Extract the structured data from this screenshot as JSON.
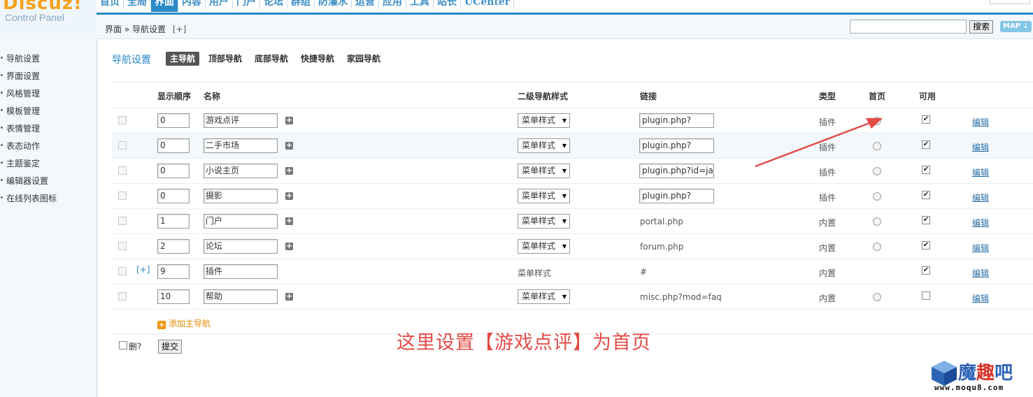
{
  "header": {
    "logo_name": "Discuz!",
    "logo_sub": "Control Panel",
    "nav": [
      "首页",
      "全局",
      "界面",
      "内容",
      "用户",
      "门户",
      "论坛",
      "群组",
      "防灌水",
      "运营",
      "应用",
      "工具",
      "站长",
      "UCenter"
    ],
    "active_nav": "界面",
    "breadcrumb": {
      "root": "界面",
      "sep": "»",
      "current": "导航设置",
      "plus": "[+]"
    },
    "search_value": "",
    "search_button": "搜索",
    "map_button": "MAP ⇣"
  },
  "sidebar": {
    "items": [
      "导航设置",
      "界面设置",
      "风格管理",
      "模板管理",
      "表情管理",
      "表态动作",
      "主题鉴定",
      "编辑器设置",
      "在线列表图标"
    ]
  },
  "page": {
    "title": "导航设置",
    "tabs": [
      "主导航",
      "顶部导航",
      "底部导航",
      "快捷导航",
      "家园导航"
    ],
    "active_tab": "主导航"
  },
  "table": {
    "headers": {
      "order": "显示顺序",
      "name": "名称",
      "substyle": "二级导航样式",
      "link": "链接",
      "type": "类型",
      "home": "首页",
      "available": "可用"
    },
    "rows": [
      {
        "expand": "",
        "order": "0",
        "name": "游戏点评",
        "has_add": true,
        "substyle": "菜单样式",
        "substyle_select": true,
        "link": "plugin.php?id=m",
        "link_input": true,
        "type": "插件",
        "home": true,
        "available": true,
        "edit": "编辑"
      },
      {
        "expand": "",
        "order": "0",
        "name": "二手市场",
        "has_add": true,
        "substyle": "菜单样式",
        "substyle_select": true,
        "link": "plugin.php?id=dz",
        "link_input": true,
        "type": "插件",
        "home": false,
        "available": true,
        "edit": "编辑"
      },
      {
        "expand": "",
        "order": "0",
        "name": "小说主页",
        "has_add": true,
        "substyle": "菜单样式",
        "substyle_select": true,
        "link": "plugin.php?id=ja",
        "link_input": true,
        "type": "插件",
        "home": false,
        "available": true,
        "edit": "编辑"
      },
      {
        "expand": "",
        "order": "0",
        "name": "摄影",
        "has_add": true,
        "substyle": "菜单样式",
        "substyle_select": true,
        "link": "plugin.php?id=cc",
        "link_input": true,
        "type": "插件",
        "home": false,
        "available": true,
        "edit": "编辑"
      },
      {
        "expand": "",
        "order": "1",
        "name": "门户",
        "has_add": true,
        "substyle": "菜单样式",
        "substyle_select": true,
        "link": "portal.php",
        "link_input": false,
        "type": "内置",
        "home": false,
        "available": true,
        "edit": "编辑"
      },
      {
        "expand": "",
        "order": "2",
        "name": "论坛",
        "has_add": true,
        "substyle": "菜单样式",
        "substyle_select": true,
        "link": "forum.php",
        "link_input": false,
        "type": "内置",
        "home": false,
        "available": true,
        "edit": "编辑"
      },
      {
        "expand": "[+]",
        "order": "9",
        "name": "插件",
        "has_add": false,
        "substyle": "菜单样式",
        "substyle_select": false,
        "link": "#",
        "link_input": false,
        "type": "内置",
        "home": null,
        "available": true,
        "edit": "编辑"
      },
      {
        "expand": "",
        "order": "10",
        "name": "帮助",
        "has_add": true,
        "substyle": "菜单样式",
        "substyle_select": true,
        "link": "misc.php?mod=faq",
        "link_input": false,
        "type": "内置",
        "home": false,
        "available": false,
        "edit": "编辑"
      }
    ],
    "add_main_nav": "添加主导航"
  },
  "footer": {
    "delete_label": "删?",
    "submit_button": "提交"
  },
  "annotation": "这里设置【游戏点评】为首页",
  "watermark": {
    "name_blue": "魔",
    "name_red": "趣",
    "name_blue2": "吧",
    "url": "www.moqu8.com"
  },
  "colors": {
    "accent": "#2b8ac6",
    "annotation": "#e34b47",
    "logo": "#f7a11b",
    "add_link": "#e28b00"
  }
}
